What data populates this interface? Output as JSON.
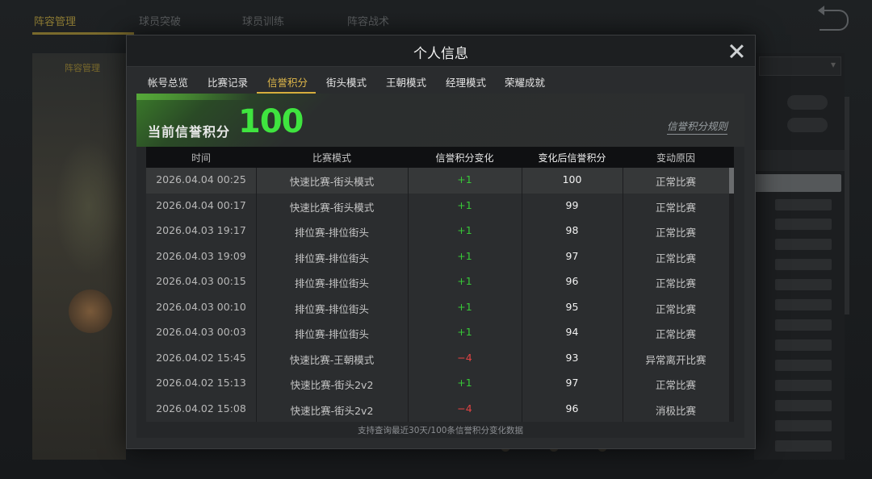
{
  "background": {
    "top_tabs": [
      "阵容管理",
      "球员突破",
      "球员训练",
      "阵容战术"
    ],
    "left_panel_tab": "阵容管理"
  },
  "modal": {
    "title": "个人信息",
    "tabs": [
      {
        "label": "帐号总览",
        "active": false
      },
      {
        "label": "比赛记录",
        "active": false
      },
      {
        "label": "信誉积分",
        "active": true
      },
      {
        "label": "街头模式",
        "active": false
      },
      {
        "label": "王朝模式",
        "active": false
      },
      {
        "label": "经理模式",
        "active": false
      },
      {
        "label": "荣耀成就",
        "active": false
      }
    ],
    "credit": {
      "label": "当前信誉积分",
      "value": "100",
      "rules_link": "信誉积分规则"
    },
    "table": {
      "headers": [
        "时间",
        "比赛模式",
        "信誉积分变化",
        "变化后信誉积分",
        "变动原因"
      ],
      "rows": [
        {
          "time": "2026.04.04  00:25",
          "mode": "快速比赛-街头模式",
          "delta": "+1",
          "after": "100",
          "reason": "正常比赛"
        },
        {
          "time": "2026.04.04  00:17",
          "mode": "快速比赛-街头模式",
          "delta": "+1",
          "after": "99",
          "reason": "正常比赛"
        },
        {
          "time": "2026.04.03  19:17",
          "mode": "排位赛-排位街头",
          "delta": "+1",
          "after": "98",
          "reason": "正常比赛"
        },
        {
          "time": "2026.04.03  19:09",
          "mode": "排位赛-排位街头",
          "delta": "+1",
          "after": "97",
          "reason": "正常比赛"
        },
        {
          "time": "2026.04.03  00:15",
          "mode": "排位赛-排位街头",
          "delta": "+1",
          "after": "96",
          "reason": "正常比赛"
        },
        {
          "time": "2026.04.03  00:10",
          "mode": "排位赛-排位街头",
          "delta": "+1",
          "after": "95",
          "reason": "正常比赛"
        },
        {
          "time": "2026.04.03  00:03",
          "mode": "排位赛-排位街头",
          "delta": "+1",
          "after": "94",
          "reason": "正常比赛"
        },
        {
          "time": "2026.04.02  15:45",
          "mode": "快速比赛-王朝模式",
          "delta": "-4",
          "after": "93",
          "reason": "异常离开比赛"
        },
        {
          "time": "2026.04.02  15:13",
          "mode": "快速比赛-街头2v2",
          "delta": "+1",
          "after": "97",
          "reason": "正常比赛"
        },
        {
          "time": "2026.04.02  15:08",
          "mode": "快速比赛-街头2v2",
          "delta": "-4",
          "after": "96",
          "reason": "消极比赛"
        }
      ]
    },
    "footer_note": "支持查询最近30天/100条信誉积分变化数据"
  },
  "colors": {
    "accent_gold": "#d6ad3d",
    "credit_green": "#3fe43f",
    "positive": "#37c837",
    "negative": "#e04343"
  },
  "icons": {
    "close": "close-icon",
    "back": "back-arrow-icon"
  }
}
